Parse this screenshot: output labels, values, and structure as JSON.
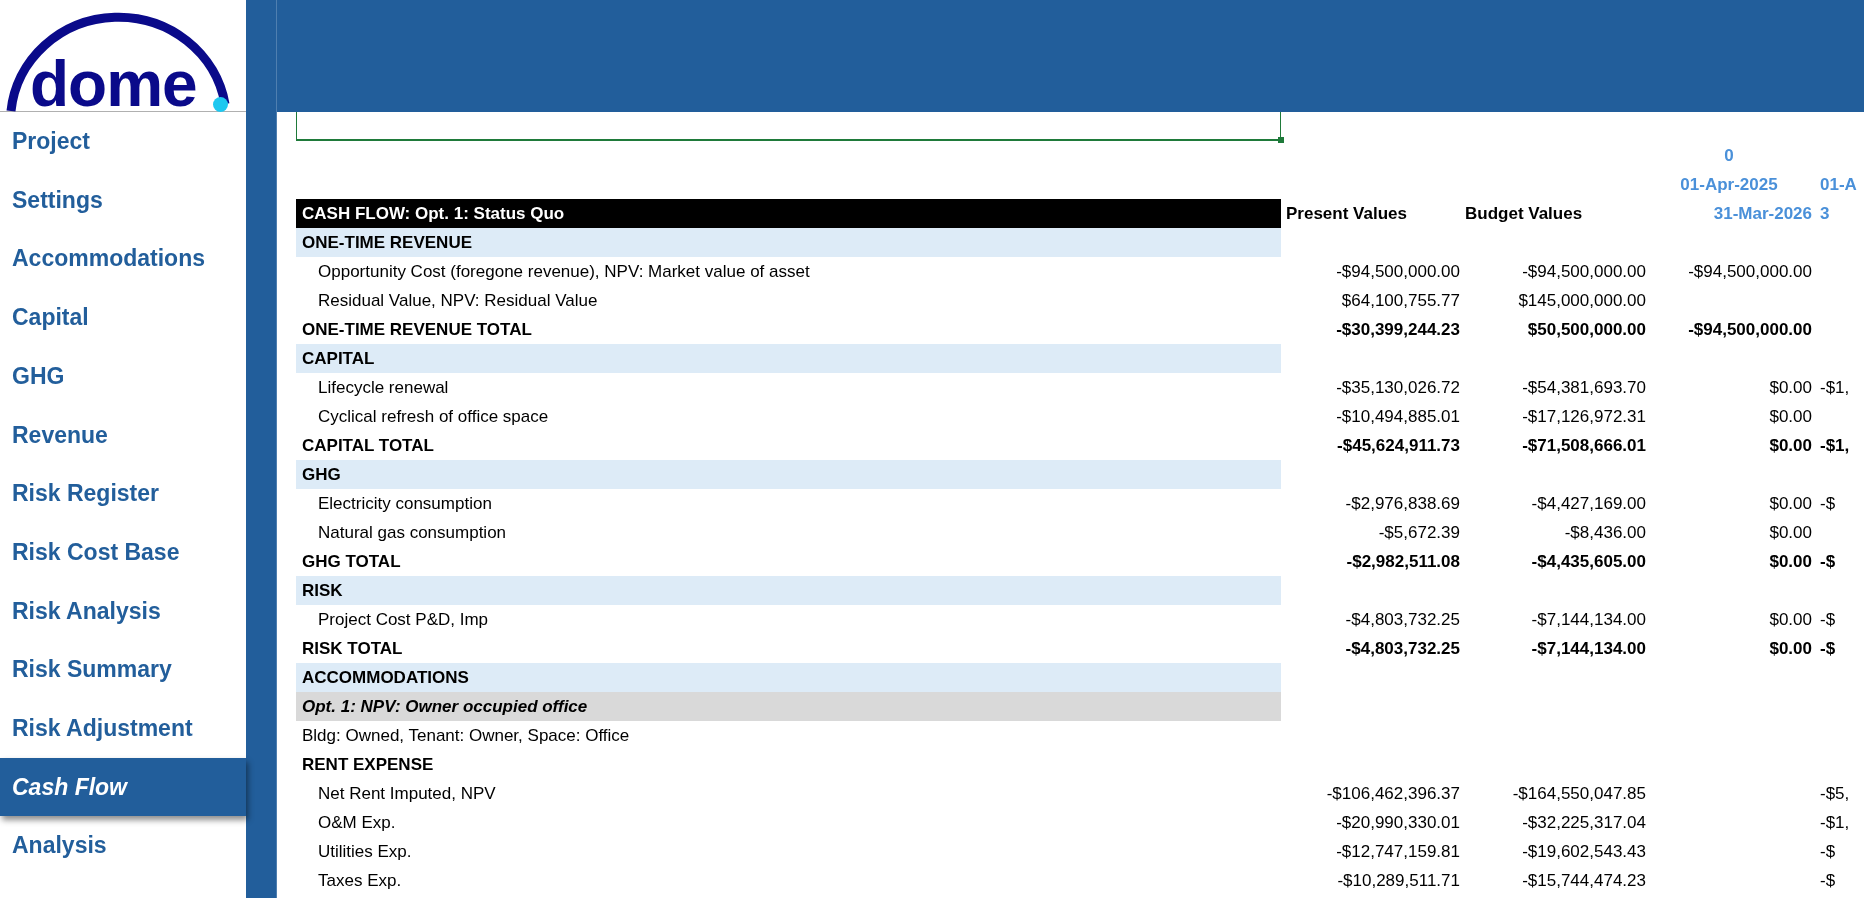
{
  "logo": {
    "text": "dome"
  },
  "nav": [
    {
      "label": "Project",
      "selected": false
    },
    {
      "label": "Settings",
      "selected": false
    },
    {
      "label": "Accommodations",
      "selected": false
    },
    {
      "label": "Capital",
      "selected": false
    },
    {
      "label": "GHG",
      "selected": false
    },
    {
      "label": "Revenue",
      "selected": false
    },
    {
      "label": "Risk Register",
      "selected": false
    },
    {
      "label": "Risk Cost Base",
      "selected": false
    },
    {
      "label": "Risk Analysis",
      "selected": false
    },
    {
      "label": "Risk Summary",
      "selected": false
    },
    {
      "label": "Risk Adjustment",
      "selected": false
    },
    {
      "label": "Cash Flow",
      "selected": true
    },
    {
      "label": "Analysis",
      "selected": false
    }
  ],
  "sheet": {
    "period_header": {
      "index": "0",
      "start": "01-Apr-2025",
      "end": "31-Mar-2026"
    },
    "next_period_header": {
      "start": "01-A",
      "end": "3"
    },
    "title": "CASH FLOW: Opt. 1: Status Quo",
    "columns": [
      "Present Values",
      "Budget Values"
    ],
    "rows": [
      {
        "kind": "section",
        "label": "ONE-TIME REVENUE"
      },
      {
        "kind": "item",
        "label": "Opportunity Cost (foregone revenue), NPV: Market value of asset",
        "present": "-$94,500,000.00",
        "budget": "-$94,500,000.00",
        "period_1": "-$94,500,000.00"
      },
      {
        "kind": "item",
        "label": "Residual Value, NPV: Residual Value",
        "present": "$64,100,755.77",
        "budget": "$145,000,000.00"
      },
      {
        "kind": "total",
        "label": "ONE-TIME REVENUE TOTAL",
        "present": "-$30,399,244.23",
        "budget": "$50,500,000.00",
        "period_1": "-$94,500,000.00"
      },
      {
        "kind": "section",
        "label": "CAPITAL"
      },
      {
        "kind": "item",
        "label": "Lifecycle renewal",
        "present": "-$35,130,026.72",
        "budget": "-$54,381,693.70",
        "period_1": "$0.00",
        "period_2": "-$1,"
      },
      {
        "kind": "item",
        "label": "Cyclical refresh of office space",
        "present": "-$10,494,885.01",
        "budget": "-$17,126,972.31",
        "period_1": "$0.00"
      },
      {
        "kind": "total",
        "label": "CAPITAL TOTAL",
        "present": "-$45,624,911.73",
        "budget": "-$71,508,666.01",
        "period_1": "$0.00",
        "period_2": "-$1,"
      },
      {
        "kind": "section",
        "label": "GHG"
      },
      {
        "kind": "item",
        "label": "Electricity consumption",
        "present": "-$2,976,838.69",
        "budget": "-$4,427,169.00",
        "period_1": "$0.00",
        "period_2": "-$"
      },
      {
        "kind": "item",
        "label": "Natural gas consumption",
        "present": "-$5,672.39",
        "budget": "-$8,436.00",
        "period_1": "$0.00"
      },
      {
        "kind": "total",
        "label": "GHG TOTAL",
        "present": "-$2,982,511.08",
        "budget": "-$4,435,605.00",
        "period_1": "$0.00",
        "period_2": "-$"
      },
      {
        "kind": "section",
        "label": "RISK"
      },
      {
        "kind": "item",
        "label": "Project Cost P&D, Imp",
        "present": "-$4,803,732.25",
        "budget": "-$7,144,134.00",
        "period_1": "$0.00",
        "period_2": "-$"
      },
      {
        "kind": "total",
        "label": "RISK TOTAL",
        "present": "-$4,803,732.25",
        "budget": "-$7,144,134.00",
        "period_1": "$0.00",
        "period_2": "-$"
      },
      {
        "kind": "section",
        "label": "ACCOMMODATIONS"
      },
      {
        "kind": "option",
        "label": "Opt. 1: NPV: Owner occupied office"
      },
      {
        "kind": "note",
        "label": "Bldg: Owned, Tenant: Owner, Space: Office"
      },
      {
        "kind": "group",
        "label": "RENT EXPENSE"
      },
      {
        "kind": "item",
        "label": "Net Rent Imputed, NPV",
        "present": "-$106,462,396.37",
        "budget": "-$164,550,047.85",
        "period_2": "-$5,"
      },
      {
        "kind": "item",
        "label": "O&M Exp.",
        "present": "-$20,990,330.01",
        "budget": "-$32,225,317.04",
        "period_2": "-$1,"
      },
      {
        "kind": "item",
        "label": "Utilities Exp.",
        "present": "-$12,747,159.81",
        "budget": "-$19,602,543.43",
        "period_2": "-$"
      },
      {
        "kind": "item",
        "label": "Taxes Exp.",
        "present": "-$10,289,511.71",
        "budget": "-$15,744,474.23",
        "period_2": "-$"
      }
    ]
  }
}
